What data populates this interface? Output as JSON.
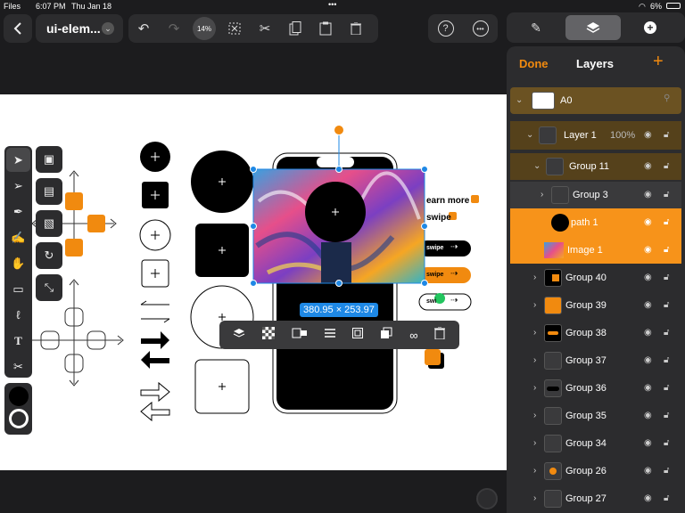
{
  "status": {
    "app": "Files",
    "time": "6:07 PM",
    "date": "Thu Jan 18",
    "battery": "6%"
  },
  "header": {
    "doc_title": "ui-elem...",
    "zoom": "14%"
  },
  "selection": {
    "size_label": "380.95 × 253.97"
  },
  "canvas_text": {
    "learn_more": "earn more",
    "swipe": "swipe",
    "swipe_btn1": "swipe",
    "swipe_btn2": "swipe",
    "swipe_btn3": "swi"
  },
  "layers_panel": {
    "done": "Done",
    "title": "Layers",
    "add": "+",
    "rows": [
      {
        "name": "A0",
        "extra": ""
      },
      {
        "name": "Layer 1",
        "extra": "100%"
      },
      {
        "name": "Group 11",
        "extra": ""
      },
      {
        "name": "Group 3",
        "extra": ""
      },
      {
        "name": "path 1",
        "extra": ""
      },
      {
        "name": "Image 1",
        "extra": ""
      },
      {
        "name": "Group 40",
        "extra": ""
      },
      {
        "name": "Group 39",
        "extra": ""
      },
      {
        "name": "Group 38",
        "extra": ""
      },
      {
        "name": "Group 37",
        "extra": ""
      },
      {
        "name": "Group 36",
        "extra": ""
      },
      {
        "name": "Group 35",
        "extra": ""
      },
      {
        "name": "Group 34",
        "extra": ""
      },
      {
        "name": "Group 26",
        "extra": ""
      },
      {
        "name": "Group 27",
        "extra": ""
      }
    ]
  },
  "colors": {
    "accent": "#f18a0f",
    "selection": "#1e88e5",
    "panel": "#2c2c2e",
    "layer_highlight": "#f7931a"
  }
}
